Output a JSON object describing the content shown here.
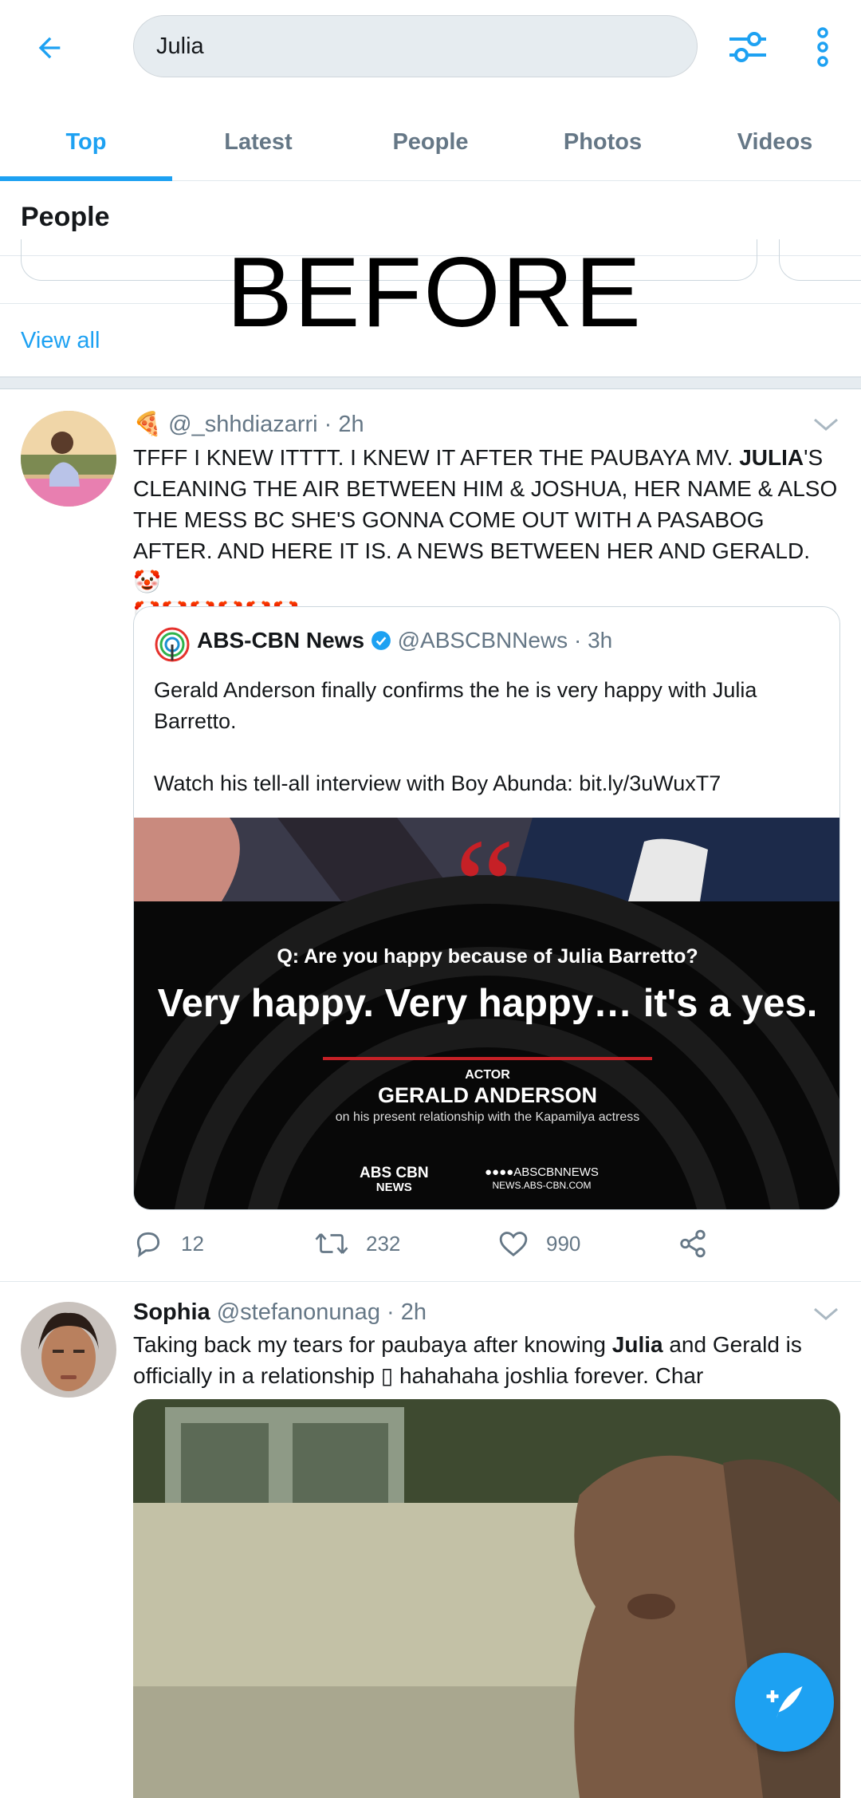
{
  "search": {
    "value": "Julia"
  },
  "tabs": [
    {
      "label": "Top"
    },
    {
      "label": "Latest"
    },
    {
      "label": "People"
    },
    {
      "label": "Photos"
    },
    {
      "label": "Videos"
    }
  ],
  "people": {
    "heading": "People",
    "view_all": "View all"
  },
  "overlay_label": "BEFORE",
  "tweet1": {
    "emoji": "🍕",
    "handle": "@_shhdiazarri",
    "time": "· 2h",
    "text_a": "TFFF I KNEW ITTTT. I KNEW IT AFTER THE PAUBAYA MV. ",
    "text_bold": "JULIA",
    "text_b": "'S CLEANING THE AIR BETWEEN HIM & JOSHUA, HER NAME & ALSO THE MESS BC SHE'S GONNA COME OUT WITH A PASABOG AFTER. AND HERE IT IS. A NEWS BETWEEN HER AND GERALD. ",
    "emoji_trail": "🤡",
    "emoji_line": "🤡🤡🤡🤡🤡🤡",
    "quote": {
      "name": "ABS-CBN News",
      "handle": "@ABSCBNNews",
      "time": "· 3h",
      "line1": "Gerald Anderson finally confirms the he is very happy with Julia Barretto.",
      "line2": "Watch his tell-all interview with Boy Abunda: bit.ly/3uWuxT7",
      "media": {
        "question": "Q: Are you happy because of Julia Barretto?",
        "answer": "Very happy. Very happy… it's a yes.",
        "role": "ACTOR",
        "person": "GERALD ANDERSON",
        "subtitle": "on his present relationship with the Kapamilya actress",
        "logo_top": "ABS CBN",
        "logo_bottom": "NEWS",
        "social": "ABSCBNNEWS",
        "site": "NEWS.ABS-CBN.COM"
      }
    },
    "replies": "12",
    "retweets": "232",
    "likes": "990"
  },
  "tweet2": {
    "name": "Sophia",
    "handle": "@stefanonunag",
    "time": "· 2h",
    "text_a": "Taking back my tears for paubaya after knowing ",
    "text_bold": "Julia",
    "text_b": " and Gerald is officially in a relationship ▯ hahahaha joshlia forever. Char"
  },
  "colors": {
    "accent": "#1da1f2",
    "muted": "#657786",
    "text": "#14171a"
  },
  "icons": [
    "back-arrow-icon",
    "filter-sliders-icon",
    "more-vertical-icon",
    "reply-icon",
    "retweet-icon",
    "like-icon",
    "share-icon",
    "chevron-down-icon",
    "verified-icon",
    "compose-icon"
  ]
}
